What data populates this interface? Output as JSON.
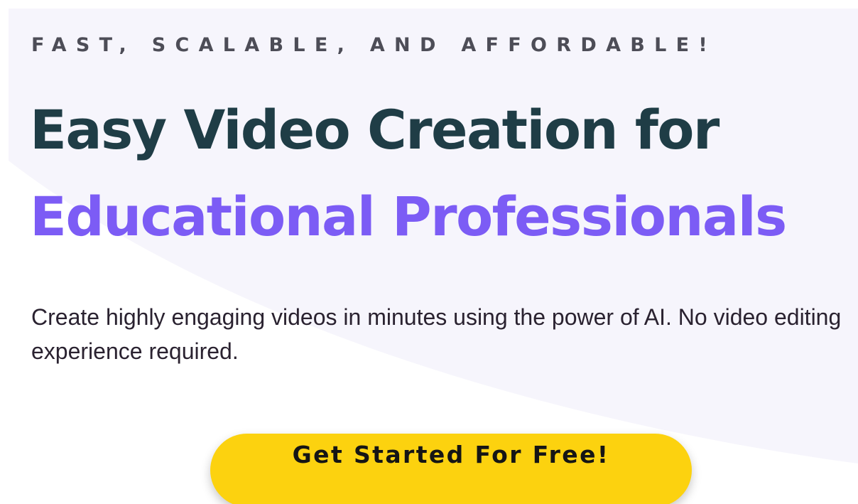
{
  "hero": {
    "eyebrow": "FAST, SCALABLE, AND AFFORDABLE!",
    "headline_line1": "Easy Video Creation for",
    "headline_line2": "Educational Professionals",
    "subtitle": "Create highly engaging videos in minutes using the power of AI. No video editing experience required.",
    "cta_label": "Get Started For Free!"
  },
  "colors": {
    "background_tint": "#f6f5fc",
    "headline_dark": "#1f3d46",
    "headline_accent": "#7c5cf5",
    "cta_background": "#fcd20f",
    "eyebrow_text": "#4d4d57"
  }
}
